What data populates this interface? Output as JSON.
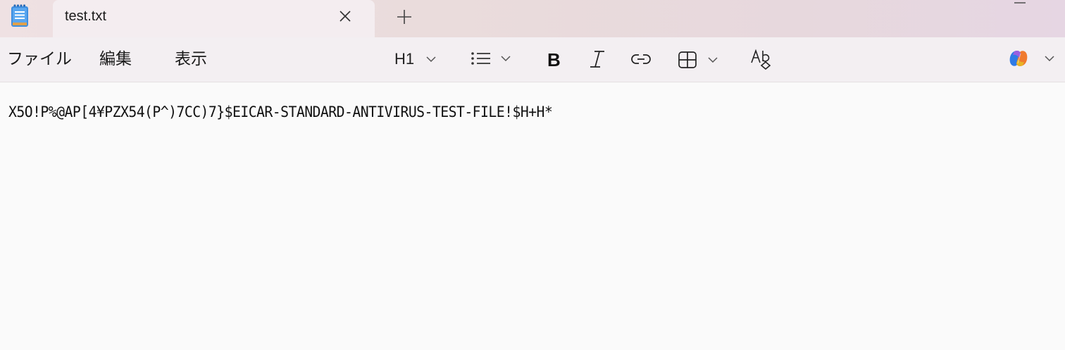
{
  "tab": {
    "title": "test.txt",
    "close_icon": "close-icon",
    "new_tab_icon": "plus-icon"
  },
  "menu": {
    "file": "ファイル",
    "edit": "編集",
    "view": "表示"
  },
  "toolbar": {
    "heading_label": "H1",
    "icons": [
      "chevron-down-icon",
      "bulleted-list-icon",
      "bold-icon",
      "italic-icon",
      "link-icon",
      "table-icon",
      "spellcheck-icon",
      "copilot-icon"
    ]
  },
  "editor": {
    "content": "X5O!P%@AP[4¥PZX54(P^)7CC)7}$EICAR-STANDARD-ANTIVIRUS-TEST-FILE!$H+H*"
  },
  "colors": {
    "tabbar_bg": "#eadcdc",
    "active_tab_bg": "#f4edf0",
    "toolbar_bg": "#f3eff2",
    "editor_bg": "#fafafa",
    "app_icon_blue": "#3d8ee0"
  }
}
